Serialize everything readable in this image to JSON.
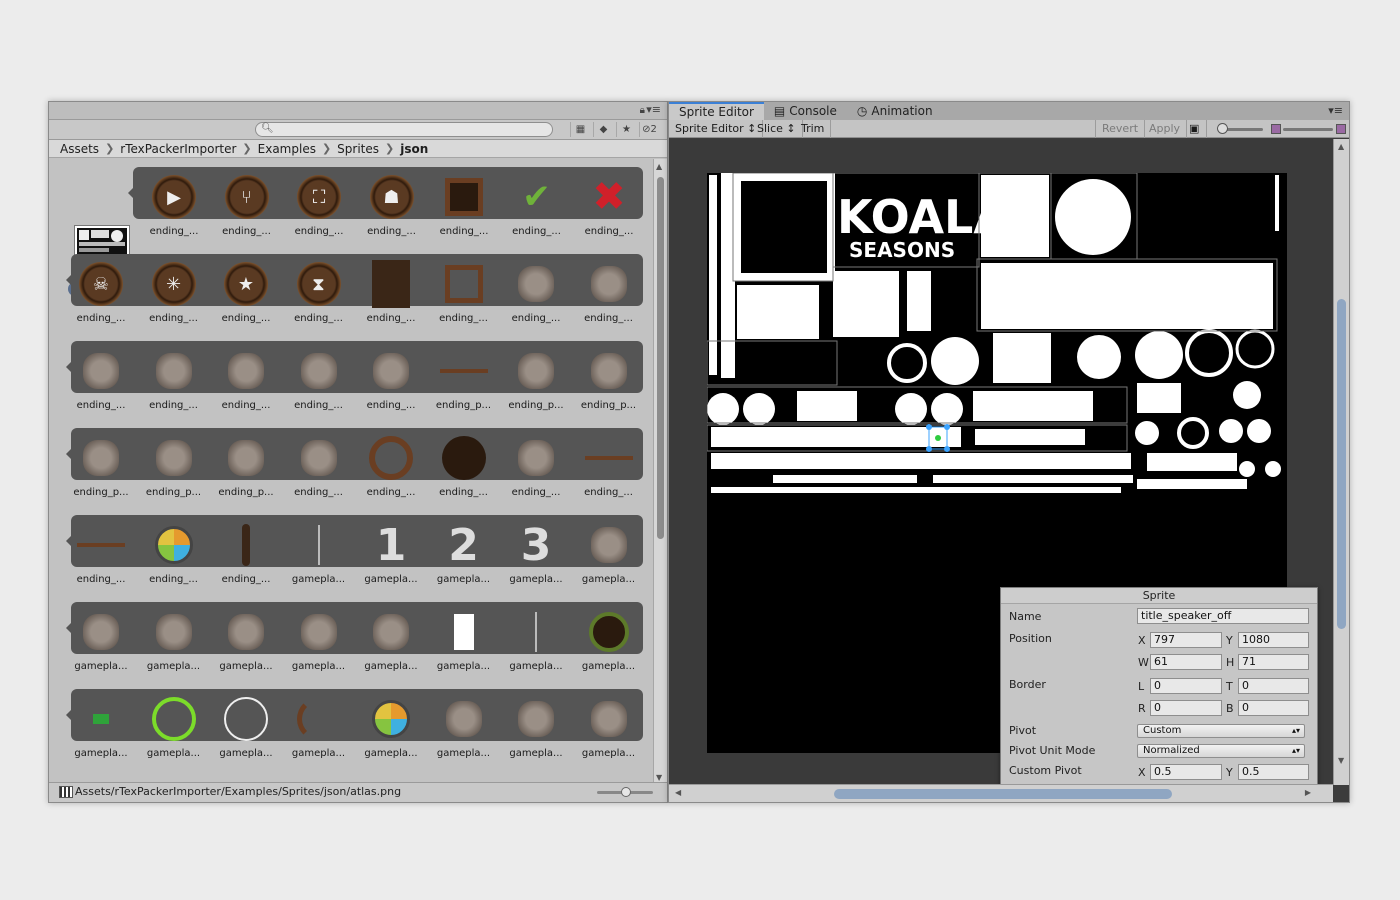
{
  "project": {
    "breadcrumb": [
      "Assets",
      "rTexPackerImporter",
      "Examples",
      "Sprites",
      "json"
    ],
    "hidden_count": "2",
    "atlas_label": "atlas",
    "rows": [
      [
        "ending_...",
        "ending_...",
        "ending_...",
        "ending_...",
        "ending_...",
        "ending_...",
        "ending_..."
      ],
      [
        "ending_...",
        "ending_...",
        "ending_...",
        "ending_...",
        "ending_...",
        "ending_...",
        "ending_...",
        "ending_..."
      ],
      [
        "ending_...",
        "ending_...",
        "ending_...",
        "ending_...",
        "ending_...",
        "ending_p...",
        "ending_p...",
        "ending_p..."
      ],
      [
        "ending_p...",
        "ending_p...",
        "ending_p...",
        "ending_...",
        "ending_...",
        "ending_...",
        "ending_...",
        "ending_..."
      ],
      [
        "ending_...",
        "ending_...",
        "ending_...",
        "gamepla...",
        "gamepla...",
        "gamepla...",
        "gamepla...",
        "gamepla..."
      ],
      [
        "gamepla...",
        "gamepla...",
        "gamepla...",
        "gamepla...",
        "gamepla...",
        "gamepla...",
        "gamepla...",
        "gamepla..."
      ],
      [
        "gamepla...",
        "gamepla...",
        "gamepla...",
        "gamepla...",
        "gamepla...",
        "gamepla...",
        "gamepla...",
        "gamepla..."
      ]
    ],
    "status_path": "Assets/rTexPackerImporter/Examples/Sprites/json/atlas.png"
  },
  "editor": {
    "tabs": [
      "Sprite Editor",
      "Console",
      "Animation"
    ],
    "toolbar": {
      "mode": "Sprite Editor",
      "slice": "Slice",
      "trim": "Trim",
      "revert": "Revert",
      "apply": "Apply"
    },
    "atlas_text": "KOALA",
    "atlas_subtext": "SEASONS",
    "sprite_panel": {
      "title": "Sprite",
      "name_label": "Name",
      "name_value": "title_speaker_off",
      "position_label": "Position",
      "x_label": "X",
      "x_value": "797",
      "y_label": "Y",
      "y_value": "1080",
      "w_label": "W",
      "w_value": "61",
      "h_label": "H",
      "h_value": "71",
      "border_label": "Border",
      "l_label": "L",
      "l_value": "0",
      "t_label": "T",
      "t_value": "0",
      "r_label": "R",
      "r_value": "0",
      "b_label": "B",
      "b_value": "0",
      "pivot_label": "Pivot",
      "pivot_value": "Custom",
      "pivot_unit_label": "Pivot Unit Mode",
      "pivot_unit_value": "Normalized",
      "custom_pivot_label": "Custom Pivot",
      "cp_x_label": "X",
      "cp_x_value": "0.5",
      "cp_y_label": "Y",
      "cp_y_value": "0.5"
    }
  }
}
